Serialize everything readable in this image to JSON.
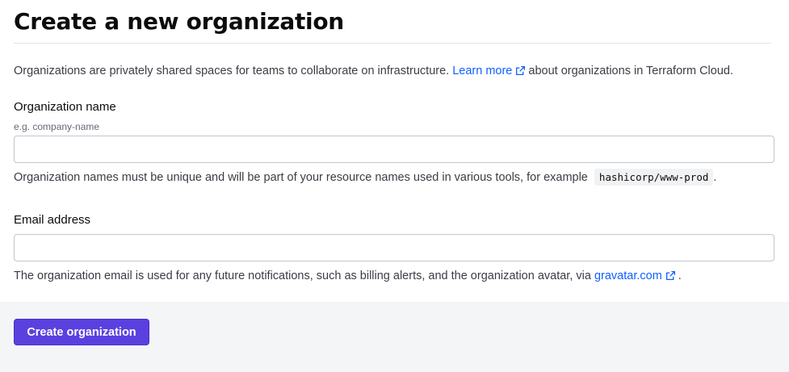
{
  "header": {
    "title": "Create a new organization"
  },
  "intro": {
    "text_before": "Organizations are privately shared spaces for teams to collaborate on infrastructure.",
    "link_text": "Learn more",
    "text_after": "about organizations in Terraform Cloud."
  },
  "org_name": {
    "label": "Organization name",
    "hint": "e.g. company-name",
    "value": "",
    "help_before": "Organization names must be unique and will be part of your resource names used in various tools, for example",
    "help_code": "hashicorp/www-prod",
    "help_after": "."
  },
  "email": {
    "label": "Email address",
    "value": "",
    "help_before": "The organization email is used for any future notifications, such as billing alerts, and the organization avatar, via",
    "link_text": "gravatar.com",
    "help_after": "."
  },
  "footer": {
    "submit_label": "Create organization"
  },
  "colors": {
    "accent": "#5b40e0",
    "link": "#1060ff",
    "footer_bg": "#f4f5f7"
  },
  "icons": {
    "external_link": "external-link-icon"
  }
}
